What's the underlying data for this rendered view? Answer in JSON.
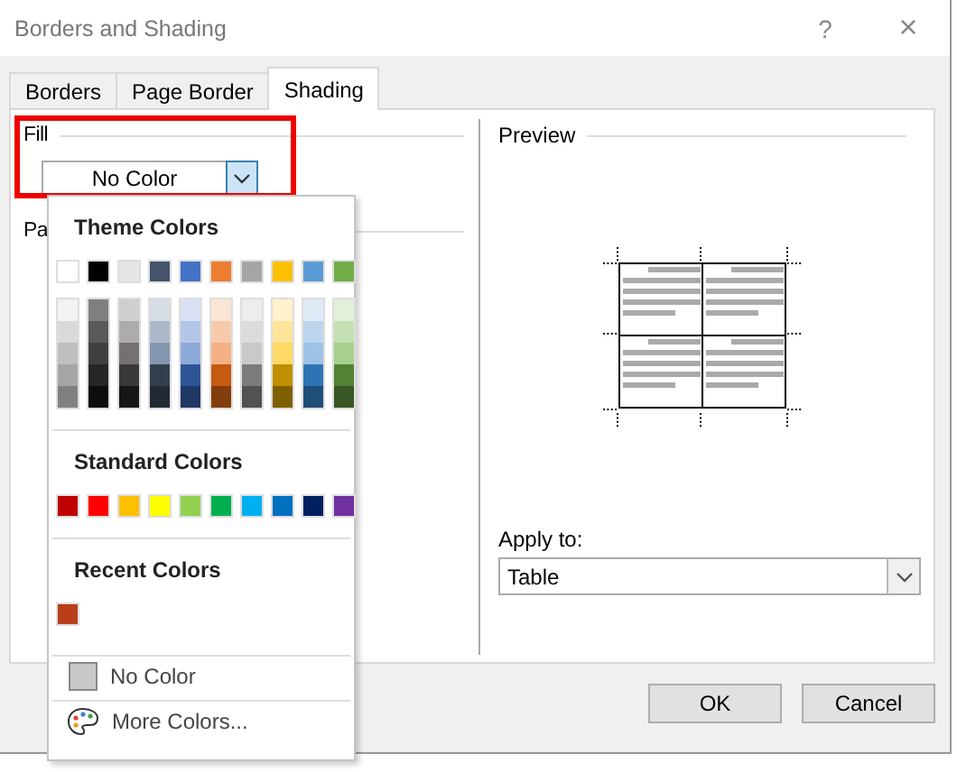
{
  "window": {
    "title": "Borders and Shading",
    "help": "?",
    "close": "×"
  },
  "tabs": [
    {
      "label": "Borders",
      "selected": false
    },
    {
      "label": "Page Border",
      "selected": false
    },
    {
      "label": "Shading",
      "selected": true
    }
  ],
  "fill": {
    "label": "Fill",
    "value": "No Color",
    "highlighted": true
  },
  "patterns": {
    "label": "Pa"
  },
  "preview": {
    "label": "Preview"
  },
  "apply_to": {
    "label": "Apply to:",
    "value": "Table"
  },
  "buttons": [
    {
      "label": "OK"
    },
    {
      "label": "Cancel"
    }
  ],
  "color_menu": {
    "theme": {
      "heading": "Theme Colors",
      "top": [
        {
          "color": "#ffffff"
        },
        {
          "color": "#000000"
        },
        {
          "color": "#e7e6e6"
        },
        {
          "color": "#44546a"
        },
        {
          "color": "#4472c4"
        },
        {
          "color": "#ed7d31"
        },
        {
          "color": "#a5a5a5"
        },
        {
          "color": "#ffc000"
        },
        {
          "color": "#5b9bd5"
        },
        {
          "color": "#70ad47"
        }
      ],
      "columns": [
        {
          "shades": [
            {
              "color": "#f2f2f2"
            },
            {
              "color": "#d9d9d9"
            },
            {
              "color": "#bfbfbf"
            },
            {
              "color": "#a6a6a6"
            },
            {
              "color": "#808080"
            }
          ]
        },
        {
          "shades": [
            {
              "color": "#7f7f7f"
            },
            {
              "color": "#595959"
            },
            {
              "color": "#404040"
            },
            {
              "color": "#262626"
            },
            {
              "color": "#0d0d0d"
            }
          ]
        },
        {
          "shades": [
            {
              "color": "#d0cece"
            },
            {
              "color": "#aeabab"
            },
            {
              "color": "#757171"
            },
            {
              "color": "#3a3838"
            },
            {
              "color": "#171616"
            }
          ]
        },
        {
          "shades": [
            {
              "color": "#d6dce4"
            },
            {
              "color": "#adb9ca"
            },
            {
              "color": "#8497b0"
            },
            {
              "color": "#333f4f"
            },
            {
              "color": "#222a35"
            }
          ]
        },
        {
          "shades": [
            {
              "color": "#d9e2f3"
            },
            {
              "color": "#b4c6e7"
            },
            {
              "color": "#8eaadb"
            },
            {
              "color": "#2f5496"
            },
            {
              "color": "#1f3864"
            }
          ]
        },
        {
          "shades": [
            {
              "color": "#fbe5d5"
            },
            {
              "color": "#f7caac"
            },
            {
              "color": "#f4b083"
            },
            {
              "color": "#c55a11"
            },
            {
              "color": "#833c0b"
            }
          ]
        },
        {
          "shades": [
            {
              "color": "#ededed"
            },
            {
              "color": "#dbdbdb"
            },
            {
              "color": "#c9c9c9"
            },
            {
              "color": "#7b7b7b"
            },
            {
              "color": "#525252"
            }
          ]
        },
        {
          "shades": [
            {
              "color": "#fff2cc"
            },
            {
              "color": "#fee599"
            },
            {
              "color": "#ffd965"
            },
            {
              "color": "#bf9000"
            },
            {
              "color": "#7f6000"
            }
          ]
        },
        {
          "shades": [
            {
              "color": "#deeaf6"
            },
            {
              "color": "#bdd6ee"
            },
            {
              "color": "#9cc2e5"
            },
            {
              "color": "#2e74b5"
            },
            {
              "color": "#1f4e79"
            }
          ]
        },
        {
          "shades": [
            {
              "color": "#e2efd9"
            },
            {
              "color": "#c5e0b3"
            },
            {
              "color": "#a8d08d"
            },
            {
              "color": "#538135"
            },
            {
              "color": "#375623"
            }
          ]
        }
      ]
    },
    "standard": {
      "heading": "Standard Colors",
      "colors": [
        {
          "color": "#c00000"
        },
        {
          "color": "#ff0000"
        },
        {
          "color": "#ffc000"
        },
        {
          "color": "#ffff00"
        },
        {
          "color": "#92d050"
        },
        {
          "color": "#00b050"
        },
        {
          "color": "#00b0f0"
        },
        {
          "color": "#0070c0"
        },
        {
          "color": "#002060"
        },
        {
          "color": "#7030a0"
        }
      ]
    },
    "recent": {
      "heading": "Recent Colors",
      "colors": [
        {
          "color": "#b83f1a"
        }
      ]
    },
    "options": [
      {
        "kind": "none",
        "label": "No Color"
      },
      {
        "kind": "more",
        "label": "More Colors..."
      }
    ]
  }
}
